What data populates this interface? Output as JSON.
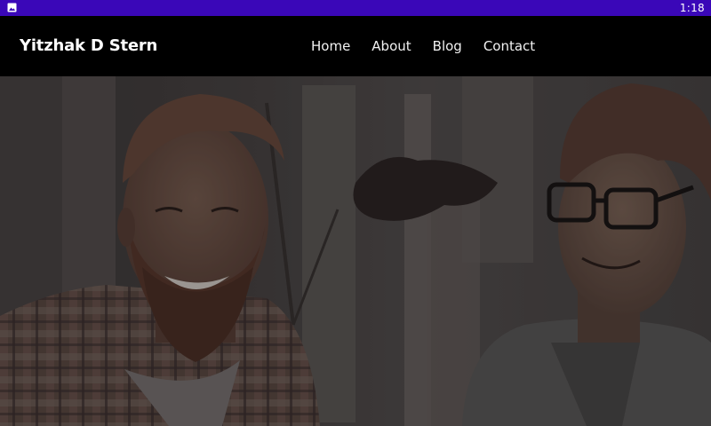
{
  "status_bar": {
    "time": "1:18",
    "left_icon": "image-icon",
    "background": "#3a07b8"
  },
  "navbar": {
    "brand": "Yitzhak D Stern",
    "links": [
      {
        "label": "Home"
      },
      {
        "label": "About"
      },
      {
        "label": "Blog"
      },
      {
        "label": "Contact"
      }
    ],
    "background": "#000000"
  },
  "hero": {
    "image": "hero-photo-two-men",
    "overlay": "dark"
  }
}
